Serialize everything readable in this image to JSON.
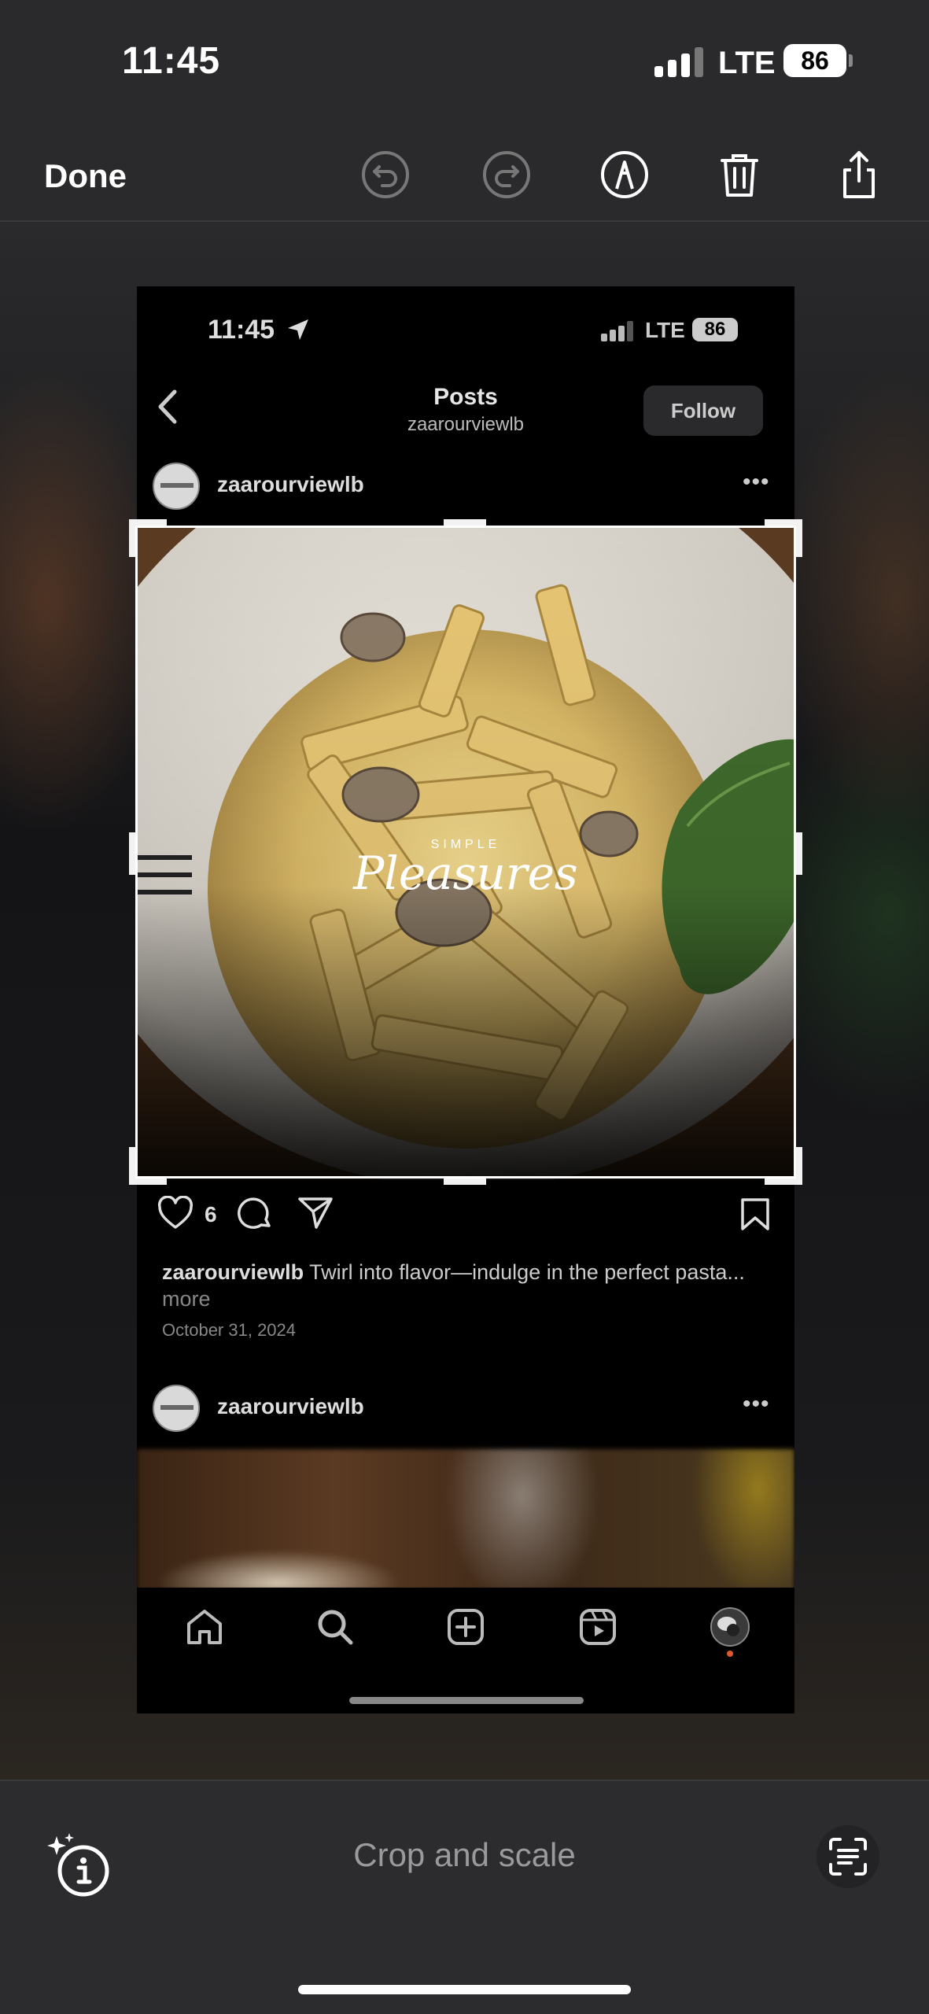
{
  "status_bar": {
    "time": "11:45",
    "network": "LTE",
    "battery": "86"
  },
  "toolbar": {
    "done_label": "Done",
    "icons": [
      "undo-icon",
      "redo-icon",
      "markup-icon",
      "trash-icon",
      "share-icon"
    ]
  },
  "screenshot": {
    "status": {
      "time": "11:45",
      "network": "LTE",
      "battery": "86"
    },
    "header": {
      "title": "Posts",
      "subtitle": "zaarourviewlb",
      "follow_label": "Follow"
    },
    "post1": {
      "username": "zaarourviewlb",
      "image_text_small": "SIMPLE",
      "image_text_script": "Pleasures",
      "likes": "6",
      "caption_user": "zaarourviewlb",
      "caption_text": "Twirl into flavor—indulge in the perfect pasta...",
      "caption_more": "more",
      "date": "October 31, 2024"
    },
    "post2": {
      "username": "zaarourviewlb"
    },
    "nav_icons": [
      "home-icon",
      "search-icon",
      "create-icon",
      "reels-icon",
      "profile-avatar"
    ]
  },
  "bottom_bar": {
    "label": "Crop and scale"
  },
  "colors": {
    "background": "#1c1c1e",
    "bar": "#2a2a2c",
    "text_secondary": "#9a9a9e"
  }
}
